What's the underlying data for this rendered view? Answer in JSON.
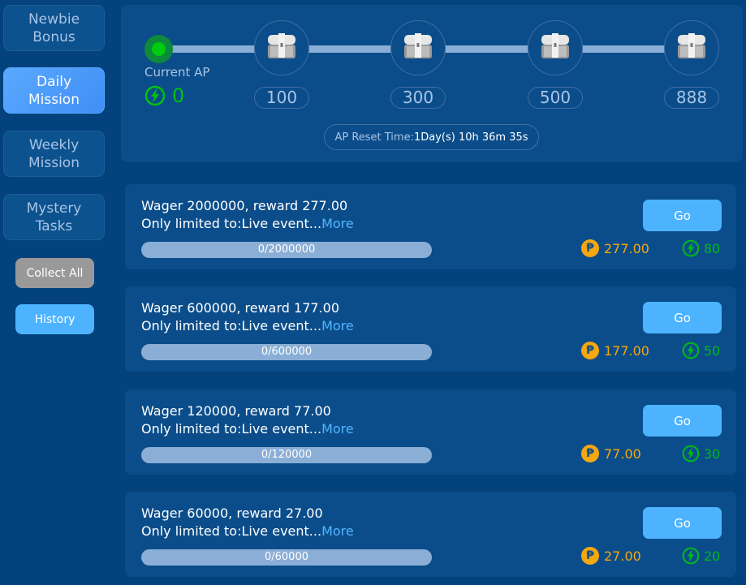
{
  "sidebar": {
    "tabs": [
      {
        "label1": "Newbie",
        "label2": "Bonus",
        "active": false
      },
      {
        "label1": "Daily",
        "label2": "Mission",
        "active": true
      },
      {
        "label1": "Weekly",
        "label2": "Mission",
        "active": false
      },
      {
        "label1": "Mystery",
        "label2": "Tasks",
        "active": false
      }
    ],
    "collect_all": "Collect All",
    "history": "History"
  },
  "progress": {
    "current_label": "Current AP",
    "current_value": "0",
    "milestones": [
      "100",
      "300",
      "500",
      "888"
    ],
    "reset_label": "AP Reset Time:",
    "reset_value": "1Day(s) 10h 36m 35s"
  },
  "missions": [
    {
      "title": "Wager 2000000, reward 277.00",
      "limit": "Only limited to:Live event...",
      "more": "More",
      "progress": "0/2000000",
      "go": "Go",
      "reward": "277.00",
      "ap": "80"
    },
    {
      "title": "Wager 600000, reward 177.00",
      "limit": "Only limited to:Live event...",
      "more": "More",
      "progress": "0/600000",
      "go": "Go",
      "reward": "177.00",
      "ap": "50"
    },
    {
      "title": "Wager 120000, reward 77.00",
      "limit": "Only limited to:Live event...",
      "more": "More",
      "progress": "0/120000",
      "go": "Go",
      "reward": "77.00",
      "ap": "30"
    },
    {
      "title": "Wager 60000, reward 27.00",
      "limit": "Only limited to:Live event...",
      "more": "More",
      "progress": "0/60000",
      "go": "Go",
      "reward": "27.00",
      "ap": "20"
    }
  ],
  "colors": {
    "background": "#03427c",
    "panel": "#0b4d8a",
    "accent": "#4db3ff",
    "coin": "#f5a70f",
    "ap": "#00c20f"
  }
}
